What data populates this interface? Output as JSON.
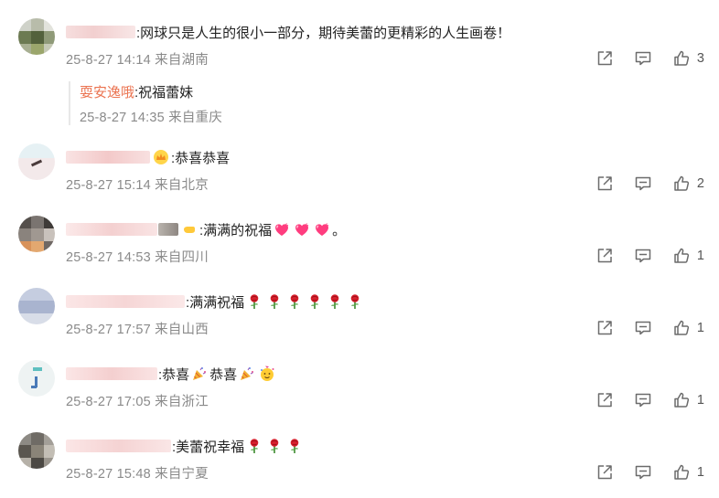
{
  "comments": [
    {
      "text": ":网球只是人生的很小一部分，期待美蕾的更精彩的人生画卷！",
      "time": "25-8-27 14:14",
      "location": "来自湖南",
      "likes": "3",
      "reply": {
        "name": "耍安逸哦",
        "text": ":祝福蕾妹",
        "time": "25-8-27 14:35",
        "location": "来自重庆"
      }
    },
    {
      "text": ":恭喜恭喜",
      "time": "25-8-27 15:14",
      "location": "来自北京",
      "likes": "2"
    },
    {
      "text": ":满满的祝福",
      "text_end": "。",
      "time": "25-8-27 14:53",
      "location": "来自四川",
      "likes": "1"
    },
    {
      "text": ":满满祝福",
      "time": "25-8-27 17:57",
      "location": "来自山西",
      "likes": "1"
    },
    {
      "text": ":恭喜",
      "text_mid": "恭喜",
      "time": "25-8-27 17:05",
      "location": "来自浙江",
      "likes": "1"
    },
    {
      "text": ":美蕾祝幸福",
      "time": "25-8-27 15:48",
      "location": "来自宁夏",
      "likes": "1"
    }
  ],
  "icons": {
    "share": "share-icon",
    "comment": "comment-icon",
    "like": "like-icon",
    "rose": "rose-emoji",
    "heart": "heart-emoji",
    "party": "party-popper-emoji",
    "crown": "crown-emoji",
    "face": "party-face-emoji"
  }
}
